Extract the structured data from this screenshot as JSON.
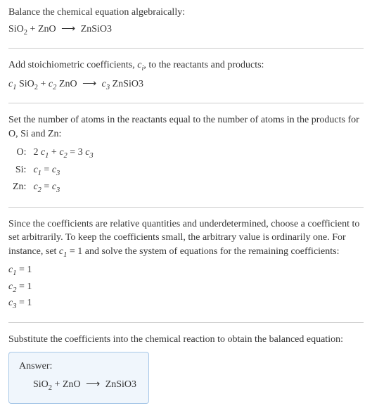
{
  "intro": {
    "line1": "Balance the chemical equation algebraically:",
    "eq_left1": "SiO",
    "eq_sub1": "2",
    "eq_plus": " + ZnO ",
    "eq_arrow": "⟶",
    "eq_right": " ZnSiO3"
  },
  "step1": {
    "text": "Add stoichiometric coefficients, ",
    "ci": "c",
    "ci_sub": "i",
    "text2": ", to the reactants and products:",
    "eq_c1": "c",
    "eq_c1sub": "1",
    "eq_sio": " SiO",
    "eq_siosub": "2",
    "eq_plus": " + ",
    "eq_c2": "c",
    "eq_c2sub": "2",
    "eq_zno": " ZnO ",
    "eq_arrow": "⟶",
    "eq_sp": " ",
    "eq_c3": "c",
    "eq_c3sub": "3",
    "eq_znsio": " ZnSiO3"
  },
  "step2": {
    "text1": "Set the number of atoms in the reactants equal to the number of atoms in the products for O, Si and Zn:",
    "rows": [
      {
        "elem": "O:",
        "lhs_a": "2 ",
        "c1": "c",
        "c1s": "1",
        "plus": " + ",
        "c2": "c",
        "c2s": "2",
        "eq": " = 3 ",
        "c3": "c",
        "c3s": "3"
      },
      {
        "elem": "Si:",
        "c1": "c",
        "c1s": "1",
        "eq": " = ",
        "c3": "c",
        "c3s": "3"
      },
      {
        "elem": "Zn:",
        "c1": "c",
        "c1s": "2",
        "eq": " = ",
        "c3": "c",
        "c3s": "3"
      }
    ]
  },
  "step3": {
    "text1": "Since the coefficients are relative quantities and underdetermined, choose a coefficient to set arbitrarily. To keep the coefficients small, the arbitrary value is ordinarily one. For instance, set ",
    "c1": "c",
    "c1s": "1",
    "text2": " = 1 and solve the system of equations for the remaining coefficients:",
    "coefs": [
      {
        "c": "c",
        "s": "1",
        "v": " = 1"
      },
      {
        "c": "c",
        "s": "2",
        "v": " = 1"
      },
      {
        "c": "c",
        "s": "3",
        "v": " = 1"
      }
    ]
  },
  "step4": {
    "text": "Substitute the coefficients into the chemical reaction to obtain the balanced equation:"
  },
  "answer": {
    "label": "Answer:",
    "eq_left1": "SiO",
    "eq_sub1": "2",
    "eq_plus": " + ZnO ",
    "eq_arrow": "⟶",
    "eq_right": " ZnSiO3"
  },
  "chart_data": {
    "type": "table",
    "title": "Balancing SiO2 + ZnO → ZnSiO3",
    "atom_equations": [
      {
        "element": "O",
        "equation": "2 c1 + c2 = 3 c3"
      },
      {
        "element": "Si",
        "equation": "c1 = c3"
      },
      {
        "element": "Zn",
        "equation": "c2 = c3"
      }
    ],
    "solution": {
      "c1": 1,
      "c2": 1,
      "c3": 1
    },
    "balanced_equation": "SiO2 + ZnO ⟶ ZnSiO3"
  }
}
